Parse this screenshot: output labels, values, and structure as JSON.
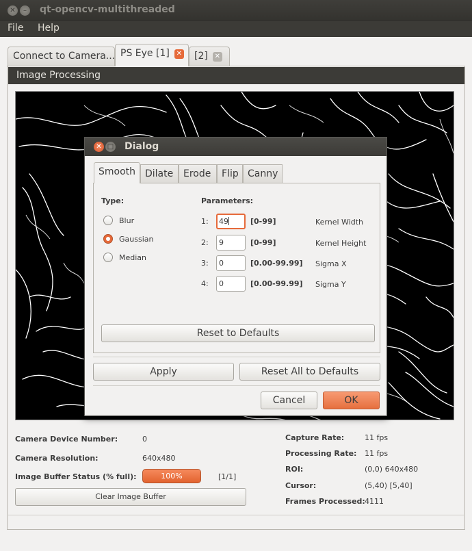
{
  "window": {
    "title": "qt-opencv-multithreaded"
  },
  "menu": [
    "File",
    "Help"
  ],
  "tabs": {
    "connect": "Connect to Camera...",
    "ps_eye": "PS Eye [1]",
    "second": "[2]"
  },
  "panel": {
    "title": "Image Processing"
  },
  "status": {
    "device_label": "Camera Device Number:",
    "device_value": "0",
    "resolution_label": "Camera Resolution:",
    "resolution_value": "640x480",
    "buffer_label": "Image Buffer Status (% full):",
    "buffer_percent_text": "100%",
    "buffer_fill": 1.0,
    "buffer_count": "[1/1]",
    "clear_button": "Clear Image Buffer",
    "capture_label": "Capture Rate:",
    "capture_value": "11 fps",
    "processing_label": "Processing Rate:",
    "processing_value": "11 fps",
    "roi_label": "ROI:",
    "roi_value": "(0,0) 640x480",
    "cursor_label": "Cursor:",
    "cursor_value": "(5,40) [5,40]",
    "frames_label": "Frames Processed:",
    "frames_value": "4111"
  },
  "dialog": {
    "title": "Dialog",
    "tabs": [
      "Smooth",
      "Dilate",
      "Erode",
      "Flip",
      "Canny"
    ],
    "type_label": "Type:",
    "params_label": "Parameters:",
    "types": [
      "Blur",
      "Gaussian",
      "Median"
    ],
    "selected_type": "Gaussian",
    "params": [
      {
        "num": "1:",
        "value": "49",
        "range": "[0-99]",
        "name": "Kernel Width"
      },
      {
        "num": "2:",
        "value": "9",
        "range": "[0-99]",
        "name": "Kernel Height"
      },
      {
        "num": "3:",
        "value": "0",
        "range": "[0.00-99.99]",
        "name": "Sigma X"
      },
      {
        "num": "4:",
        "value": "0",
        "range": "[0.00-99.99]",
        "name": "Sigma Y"
      }
    ],
    "reset_defaults": "Reset to Defaults",
    "apply": "Apply",
    "reset_all": "Reset All to Defaults",
    "cancel": "Cancel",
    "ok": "OK"
  },
  "colors": {
    "accent": "#e66a3a",
    "titlebar": "#3c3b37",
    "window_bg": "#f2f1f0"
  }
}
